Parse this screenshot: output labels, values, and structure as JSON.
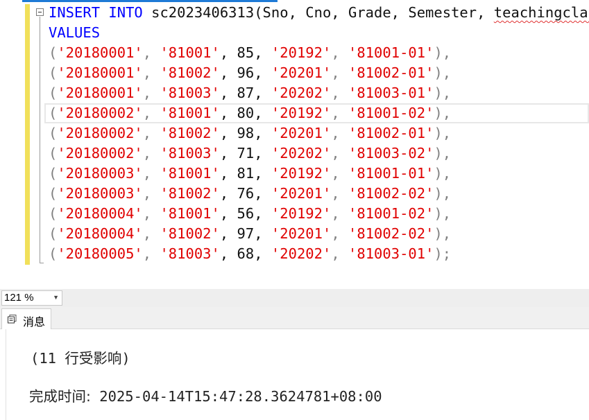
{
  "editor": {
    "lines": [
      [
        {
          "t": "INSERT INTO",
          "c": "kw"
        },
        {
          "t": " sc2023406313(Sno, Cno, Grade, Semester, ",
          "c": ""
        },
        {
          "t": "teachingclass",
          "c": "sq"
        },
        {
          "t": ")",
          "c": ""
        }
      ],
      [
        {
          "t": "VALUES",
          "c": "kw"
        }
      ],
      [
        {
          "t": "(",
          "c": "punc"
        },
        {
          "t": "'20180001'",
          "c": "str"
        },
        {
          "t": ", ",
          "c": "punc"
        },
        {
          "t": "'81001'",
          "c": "str"
        },
        {
          "t": ", 85, ",
          "c": ""
        },
        {
          "t": "'20192'",
          "c": "str"
        },
        {
          "t": ", ",
          "c": "punc"
        },
        {
          "t": "'81001-01'",
          "c": "str"
        },
        {
          "t": "),",
          "c": "punc"
        }
      ],
      [
        {
          "t": "(",
          "c": "punc"
        },
        {
          "t": "'20180001'",
          "c": "str"
        },
        {
          "t": ", ",
          "c": "punc"
        },
        {
          "t": "'81002'",
          "c": "str"
        },
        {
          "t": ", 96, ",
          "c": ""
        },
        {
          "t": "'20201'",
          "c": "str"
        },
        {
          "t": ", ",
          "c": "punc"
        },
        {
          "t": "'81002-01'",
          "c": "str"
        },
        {
          "t": "),",
          "c": "punc"
        }
      ],
      [
        {
          "t": "(",
          "c": "punc"
        },
        {
          "t": "'20180001'",
          "c": "str"
        },
        {
          "t": ", ",
          "c": "punc"
        },
        {
          "t": "'81003'",
          "c": "str"
        },
        {
          "t": ", 87, ",
          "c": ""
        },
        {
          "t": "'20202'",
          "c": "str"
        },
        {
          "t": ", ",
          "c": "punc"
        },
        {
          "t": "'81003-01'",
          "c": "str"
        },
        {
          "t": "),",
          "c": "punc"
        }
      ],
      [
        {
          "t": "(",
          "c": "punc"
        },
        {
          "t": "'20180002'",
          "c": "str"
        },
        {
          "t": ", ",
          "c": "punc"
        },
        {
          "t": "'81001'",
          "c": "str"
        },
        {
          "t": ", 80, ",
          "c": ""
        },
        {
          "t": "'20192'",
          "c": "str"
        },
        {
          "t": ", ",
          "c": "punc"
        },
        {
          "t": "'81001-02'",
          "c": "str"
        },
        {
          "t": "),",
          "c": "punc"
        }
      ],
      [
        {
          "t": "(",
          "c": "punc"
        },
        {
          "t": "'20180002'",
          "c": "str"
        },
        {
          "t": ", ",
          "c": "punc"
        },
        {
          "t": "'81002'",
          "c": "str"
        },
        {
          "t": ", 98, ",
          "c": ""
        },
        {
          "t": "'20201'",
          "c": "str"
        },
        {
          "t": ", ",
          "c": "punc"
        },
        {
          "t": "'81002-01'",
          "c": "str"
        },
        {
          "t": "),",
          "c": "punc"
        }
      ],
      [
        {
          "t": "(",
          "c": "punc"
        },
        {
          "t": "'20180002'",
          "c": "str"
        },
        {
          "t": ", ",
          "c": "punc"
        },
        {
          "t": "'81003'",
          "c": "str"
        },
        {
          "t": ", 71, ",
          "c": ""
        },
        {
          "t": "'20202'",
          "c": "str"
        },
        {
          "t": ", ",
          "c": "punc"
        },
        {
          "t": "'81003-02'",
          "c": "str"
        },
        {
          "t": "),",
          "c": "punc"
        }
      ],
      [
        {
          "t": "(",
          "c": "punc"
        },
        {
          "t": "'20180003'",
          "c": "str"
        },
        {
          "t": ", ",
          "c": "punc"
        },
        {
          "t": "'81001'",
          "c": "str"
        },
        {
          "t": ", 81, ",
          "c": ""
        },
        {
          "t": "'20192'",
          "c": "str"
        },
        {
          "t": ", ",
          "c": "punc"
        },
        {
          "t": "'81001-01'",
          "c": "str"
        },
        {
          "t": "),",
          "c": "punc"
        }
      ],
      [
        {
          "t": "(",
          "c": "punc"
        },
        {
          "t": "'20180003'",
          "c": "str"
        },
        {
          "t": ", ",
          "c": "punc"
        },
        {
          "t": "'81002'",
          "c": "str"
        },
        {
          "t": ", 76, ",
          "c": ""
        },
        {
          "t": "'20201'",
          "c": "str"
        },
        {
          "t": ", ",
          "c": "punc"
        },
        {
          "t": "'81002-02'",
          "c": "str"
        },
        {
          "t": "),",
          "c": "punc"
        }
      ],
      [
        {
          "t": "(",
          "c": "punc"
        },
        {
          "t": "'20180004'",
          "c": "str"
        },
        {
          "t": ", ",
          "c": "punc"
        },
        {
          "t": "'81001'",
          "c": "str"
        },
        {
          "t": ", 56, ",
          "c": ""
        },
        {
          "t": "'20192'",
          "c": "str"
        },
        {
          "t": ", ",
          "c": "punc"
        },
        {
          "t": "'81001-02'",
          "c": "str"
        },
        {
          "t": "),",
          "c": "punc"
        }
      ],
      [
        {
          "t": "(",
          "c": "punc"
        },
        {
          "t": "'20180004'",
          "c": "str"
        },
        {
          "t": ", ",
          "c": "punc"
        },
        {
          "t": "'81002'",
          "c": "str"
        },
        {
          "t": ", 97, ",
          "c": ""
        },
        {
          "t": "'20201'",
          "c": "str"
        },
        {
          "t": ", ",
          "c": "punc"
        },
        {
          "t": "'81002-02'",
          "c": "str"
        },
        {
          "t": "),",
          "c": "punc"
        }
      ],
      [
        {
          "t": "(",
          "c": "punc"
        },
        {
          "t": "'20180005'",
          "c": "str"
        },
        {
          "t": ", ",
          "c": "punc"
        },
        {
          "t": "'81003'",
          "c": "str"
        },
        {
          "t": ", 68, ",
          "c": ""
        },
        {
          "t": "'20202'",
          "c": "str"
        },
        {
          "t": ", ",
          "c": "punc"
        },
        {
          "t": "'81003-01'",
          "c": "str"
        },
        {
          "t": ");",
          "c": "punc"
        }
      ]
    ]
  },
  "zoom": {
    "value": "121 %",
    "arrow_icon": "dropdown-arrow-icon"
  },
  "results": {
    "tab_label": "消息",
    "tab_icon": "messages-icon",
    "rows_affected": "(11 行受影响)",
    "completion_label": "完成时间:",
    "completion_time": " 2025-04-14T15:47:28.3624781+08:00"
  },
  "colors": {
    "keyword": "#0000ff",
    "string": "#e00000",
    "punctuation": "#808080",
    "change_bar": "#f1e05a",
    "accent": "#1e7ad6"
  }
}
